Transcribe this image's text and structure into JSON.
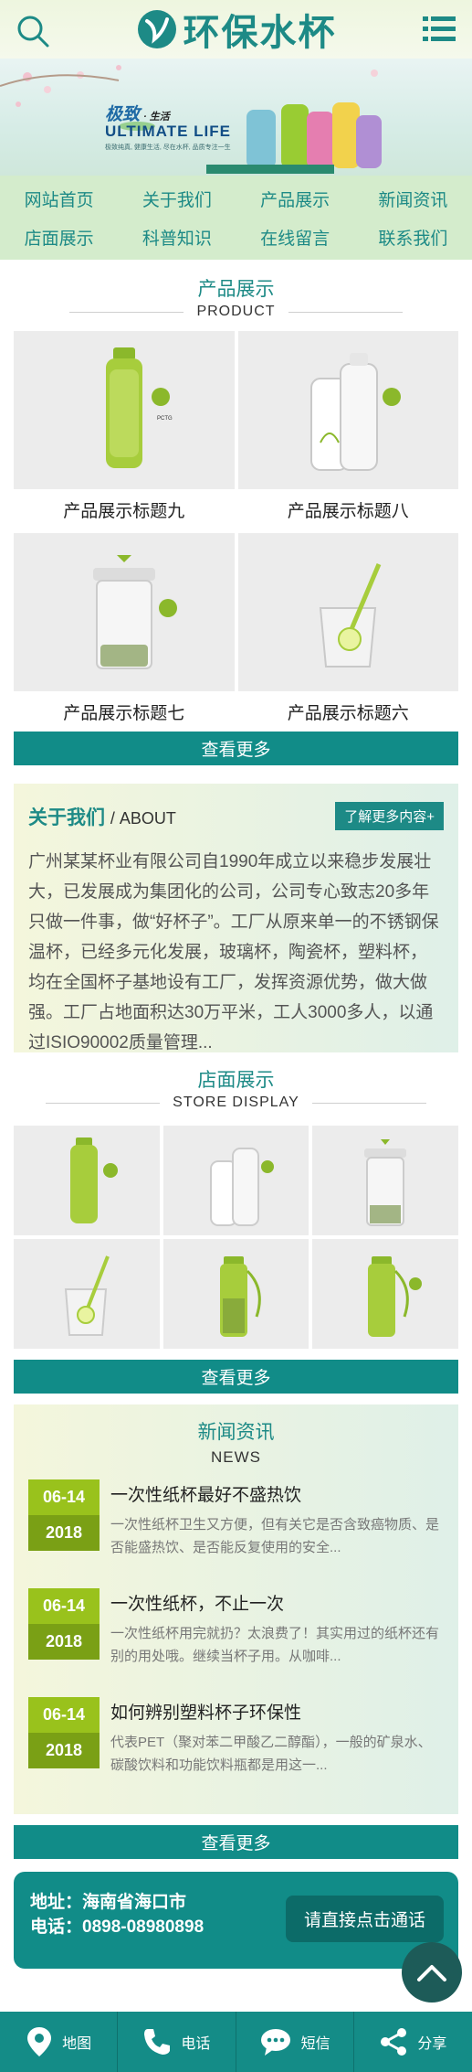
{
  "header": {
    "logo_text": "环保水杯",
    "search_icon": "search-icon",
    "menu_icon": "menu-icon"
  },
  "banner": {
    "tag": "极致",
    "tag2": "· 生活",
    "en": "ULTIMATE LIFE",
    "sub": "极致纯真, 健康生活, 尽在水杯, 品质专注一生"
  },
  "nav": [
    "网站首页",
    "关于我们",
    "产品展示",
    "新闻资讯",
    "店面展示",
    "科普知识",
    "在线留言",
    "联系我们"
  ],
  "products_section": {
    "title": "产品展示",
    "subtitle": "PRODUCT",
    "items": [
      {
        "title": "产品展示标题九"
      },
      {
        "title": "产品展示标题八"
      },
      {
        "title": "产品展示标题七"
      },
      {
        "title": "产品展示标题六"
      }
    ],
    "more": "查看更多"
  },
  "about": {
    "title": "关于我们",
    "title_en": "/ ABOUT",
    "more": "了解更多内容+",
    "text": "广州某某杯业有限公司自1990年成立以来稳步发展壮大，已发展成为集团化的公司，公司专心致志20多年只做一件事，做“好杯子”。工厂从原来单一的不锈钢保温杯，已经多元化发展，玻璃杯，陶瓷杯，塑料杯，均在全国杯子基地设有工厂，发挥资源优势，做大做强。工厂占地面积达30万平米，工人3000多人，以通过ISIO90002质量管理..."
  },
  "store_section": {
    "title": "店面展示",
    "subtitle": "STORE DISPLAY",
    "more": "查看更多"
  },
  "news_section": {
    "title": "新闻资讯",
    "subtitle": "NEWS",
    "more": "查看更多",
    "items": [
      {
        "md": "06-14",
        "year": "2018",
        "title": "一次性纸杯最好不盛热饮",
        "desc": "一次性纸杯卫生又方便，但有关它是否含致癌物质、是否能盛热饮、是否能反复使用的安全..."
      },
      {
        "md": "06-14",
        "year": "2018",
        "title": "一次性纸杯，不止一次",
        "desc": "一次性纸杯用完就扔？太浪费了！其实用过的纸杯还有别的用处哦。继续当杯子用。从咖啡..."
      },
      {
        "md": "06-14",
        "year": "2018",
        "title": "如何辨别塑料杯子环保性",
        "desc": "代表PET（聚对苯二甲酸乙二醇酯），一般的矿泉水、碳酸饮料和功能饮料瓶都是用这一..."
      }
    ]
  },
  "contact": {
    "address": "地址：海南省海口市",
    "phone": "电话：0898-08980898",
    "call": "请直接点击通话"
  },
  "footer": [
    {
      "label": "地图",
      "icon": "map-pin-icon"
    },
    {
      "label": "电话",
      "icon": "phone-icon"
    },
    {
      "label": "短信",
      "icon": "message-icon"
    },
    {
      "label": "分享",
      "icon": "share-icon"
    }
  ],
  "colors": {
    "primary": "#1d8a86",
    "button": "#118c88",
    "date": "#99c21c",
    "nav_bg": "#d4eccc"
  }
}
